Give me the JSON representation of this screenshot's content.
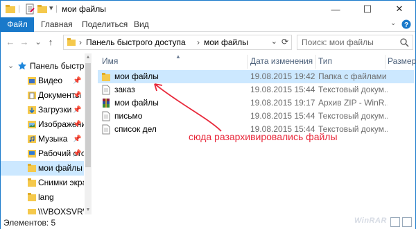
{
  "window": {
    "title": "мои файлы",
    "controls": {
      "minimize": "—",
      "maximize": "☐",
      "close": "✕"
    }
  },
  "ribbon": {
    "tabs": [
      {
        "label": "Файл",
        "active": true
      },
      {
        "label": "Главная",
        "active": false
      },
      {
        "label": "Поделиться",
        "active": false
      },
      {
        "label": "Вид",
        "active": false
      }
    ],
    "expand_icon": "chevron-down",
    "help_icon": "help"
  },
  "address": {
    "back": "←",
    "forward": "→",
    "recent": "⌄",
    "up": "↑",
    "breadcrumb": [
      "Панель быстрого доступа",
      "мои файлы"
    ],
    "separator": "›",
    "dropdown": "⌄",
    "refresh": "⟳"
  },
  "search": {
    "placeholder": "Поиск: мои файлы"
  },
  "navpane": {
    "root": {
      "label": "Панель быстрого",
      "chevron": "⌄"
    },
    "items": [
      {
        "label": "Видео",
        "icon": "video-folder-icon",
        "pinned": true,
        "selected": false
      },
      {
        "label": "Документы",
        "icon": "documents-folder-icon",
        "pinned": true,
        "selected": false
      },
      {
        "label": "Загрузки",
        "icon": "downloads-folder-icon",
        "pinned": true,
        "selected": false
      },
      {
        "label": "Изображения",
        "icon": "pictures-folder-icon",
        "pinned": true,
        "selected": false
      },
      {
        "label": "Музыка",
        "icon": "music-folder-icon",
        "pinned": true,
        "selected": false
      },
      {
        "label": "Рабочий стол",
        "icon": "desktop-folder-icon",
        "pinned": true,
        "selected": false
      },
      {
        "label": "мои файлы",
        "icon": "folder-icon",
        "pinned": false,
        "selected": true
      },
      {
        "label": "Снимки экрана",
        "icon": "folder-icon",
        "pinned": false,
        "selected": false
      },
      {
        "label": "lang",
        "icon": "folder-icon",
        "pinned": false,
        "selected": false
      },
      {
        "label": "\\\\VBOXSVR\\w",
        "icon": "network-folder-icon",
        "pinned": false,
        "selected": false
      }
    ],
    "pin_glyph": "📌"
  },
  "list": {
    "columns": [
      "Имя",
      "Дата изменения",
      "Тип",
      "Размер"
    ],
    "rows": [
      {
        "name": "мои файлы",
        "date": "19.08.2015 19:42",
        "type": "Папка с файлами",
        "icon": "folder-icon",
        "selected": true
      },
      {
        "name": "заказ",
        "date": "19.08.2015 15:44",
        "type": "Текстовый докум...",
        "icon": "text-file-icon",
        "selected": false
      },
      {
        "name": "мои файлы",
        "date": "19.08.2015 19:17",
        "type": "Архив ZIP - WinR...",
        "icon": "winrar-archive-icon",
        "selected": false
      },
      {
        "name": "письмо",
        "date": "19.08.2015 15:44",
        "type": "Текстовый докум...",
        "icon": "text-file-icon",
        "selected": false
      },
      {
        "name": "список дел",
        "date": "19.08.2015 15:44",
        "type": "Текстовый докум...",
        "icon": "text-file-icon",
        "selected": false
      }
    ]
  },
  "annotation": {
    "text": "сюда разархивировались файлы",
    "color": "#e8283a"
  },
  "status": {
    "text": "Элементов: 5"
  },
  "watermark": "WinRAR",
  "colors": {
    "accent": "#1979ca",
    "selection": "#cce8ff",
    "folder": "#f5c94c"
  }
}
